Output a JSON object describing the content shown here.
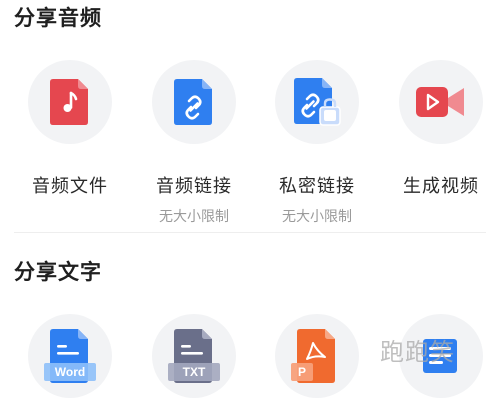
{
  "sections": [
    {
      "title": "分享音频",
      "items": [
        {
          "label": "音频文件",
          "sub": "",
          "icon": "music-file-icon",
          "color": "#e5474f"
        },
        {
          "label": "音频链接",
          "sub": "无大小限制",
          "icon": "link-file-icon",
          "color": "#2f7ff0"
        },
        {
          "label": "私密链接",
          "sub": "无大小限制",
          "icon": "private-link-icon",
          "color": "#2f7ff0"
        },
        {
          "label": "生成视频",
          "sub": "",
          "icon": "video-icon",
          "color": "#e5474f"
        }
      ]
    },
    {
      "title": "分享文字",
      "items": [
        {
          "label": "Word",
          "icon": "word-file-icon",
          "color": "#2f7ff0"
        },
        {
          "label": "TXT",
          "icon": "txt-file-icon",
          "color": "#6a6f8a"
        },
        {
          "label": "P",
          "icon": "pdf-file-icon",
          "color": "#f06a2f"
        },
        {
          "label": "",
          "icon": "doc-lines-icon",
          "color": "#2f7ff0"
        }
      ]
    }
  ],
  "watermark": "跑跑笑"
}
